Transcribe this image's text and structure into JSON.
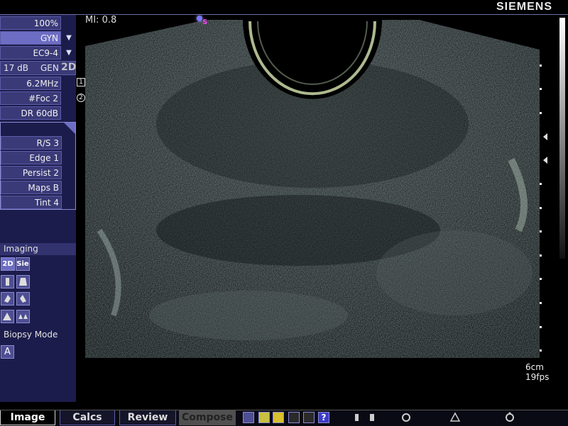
{
  "header": {
    "brand": "SIEMENS",
    "mi": "MI: 0.8"
  },
  "params": [
    {
      "label": "100%"
    },
    {
      "label": "GYN"
    },
    {
      "label": "EC9-4"
    },
    {
      "label": "6.2MHz"
    },
    {
      "label": "#Foc 2"
    },
    {
      "label": "DR 60dB"
    }
  ],
  "gain": {
    "label": "17 dB",
    "preset": "GEN",
    "mode": "2D"
  },
  "focal_markers": [
    "1",
    "2"
  ],
  "post_params": [
    {
      "label": "R/S 3"
    },
    {
      "label": "Edge 1"
    },
    {
      "label": "Persist 2"
    },
    {
      "label": "Maps B"
    },
    {
      "label": "Tint 4"
    }
  ],
  "imaging": {
    "title": "Imaging",
    "btn_2d": "2D",
    "btn_sie": "Sie",
    "biopsy_label": "Biopsy Mode",
    "biopsy_btn": "A"
  },
  "probe_marker": "S",
  "readout": {
    "depth": "6cm",
    "fps": "19fps"
  },
  "tabs": [
    {
      "label": "Image"
    },
    {
      "label": "Calcs"
    },
    {
      "label": "Review"
    },
    {
      "label": "Compose"
    }
  ],
  "colors": {
    "panel": "#1c1c4c",
    "param_bg": "#3a3a78",
    "param_selected": "#6d6dc4",
    "accent_yellow": "#e6e600"
  }
}
